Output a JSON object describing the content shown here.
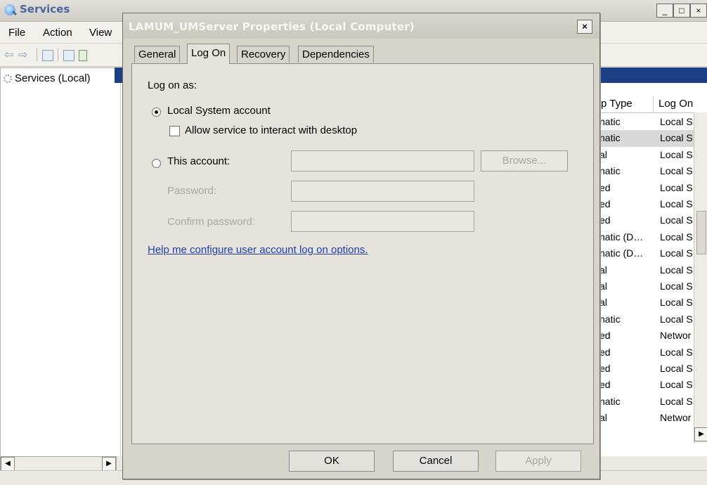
{
  "services_window": {
    "title": "Services",
    "window_buttons": [
      "_",
      "□",
      "×"
    ],
    "menu": [
      "File",
      "Action",
      "View"
    ],
    "tree_root": "Services (Local)",
    "columns": [
      "p Type",
      "Log On"
    ],
    "rows": [
      {
        "startup": "natic",
        "logon": "Local S"
      },
      {
        "startup": "natic",
        "logon": "Local S"
      },
      {
        "startup": "al",
        "logon": "Local S"
      },
      {
        "startup": "natic",
        "logon": "Local S"
      },
      {
        "startup": "ed",
        "logon": "Local S"
      },
      {
        "startup": "ed",
        "logon": "Local S"
      },
      {
        "startup": "ed",
        "logon": "Local S"
      },
      {
        "startup": "natic (D…",
        "logon": "Local S"
      },
      {
        "startup": "natic (D…",
        "logon": "Local S"
      },
      {
        "startup": "al",
        "logon": "Local S"
      },
      {
        "startup": "al",
        "logon": "Local S"
      },
      {
        "startup": "al",
        "logon": "Local S"
      },
      {
        "startup": "natic",
        "logon": "Local S"
      },
      {
        "startup": "ed",
        "logon": "Networ"
      },
      {
        "startup": "ed",
        "logon": "Local S"
      },
      {
        "startup": "ed",
        "logon": "Local S"
      },
      {
        "startup": "ed",
        "logon": "Local S"
      },
      {
        "startup": "natic",
        "logon": "Local S"
      },
      {
        "startup": "al",
        "logon": "Networ"
      }
    ],
    "selected_row": 1
  },
  "dialog": {
    "title": "LAMUM_UMServer Properties (Local Computer)",
    "close_glyph": "×",
    "tabs": [
      "General",
      "Log On",
      "Recovery",
      "Dependencies"
    ],
    "active_tab": "Log On",
    "logon_as_label": "Log on as:",
    "local_system_label": "Local System account",
    "interact_desktop_label": "Allow service to interact with desktop",
    "this_account_label": "This account:",
    "browse_label": "Browse...",
    "password_label": "Password:",
    "confirm_password_label": "Confirm password:",
    "help_link": "Help me configure user account log on options.",
    "ok_label": "OK",
    "cancel_label": "Cancel",
    "apply_label": "Apply",
    "selected_option": "Local System account",
    "interact_checked": false
  }
}
